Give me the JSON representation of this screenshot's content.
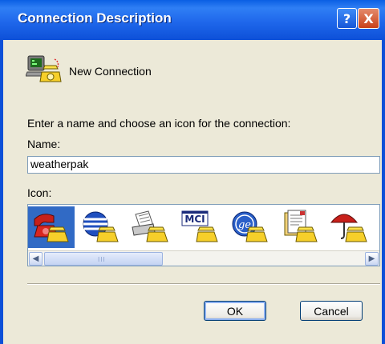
{
  "titlebar": {
    "title": "Connection Description",
    "help_glyph": "?",
    "close_glyph": "X"
  },
  "connection": {
    "icon": "hyperterminal-phone-icon",
    "label": "New Connection"
  },
  "prompt": "Enter a name and choose an icon for the connection:",
  "name_field": {
    "label": "Name:",
    "value": "weatherpak"
  },
  "icon_picker": {
    "label": "Icon:",
    "selected_index": 0,
    "icons": [
      "red-phone-icon",
      "globe-phone-icon",
      "fax-phone-icon",
      "mci-phone-icon",
      "ge-phone-icon",
      "document-phone-icon",
      "umbrella-phone-icon"
    ],
    "scroll_grip": "III"
  },
  "buttons": {
    "ok": "OK",
    "cancel": "Cancel"
  },
  "colors": {
    "titlebar": "#0d50d8",
    "body": "#ece9d8",
    "selection": "#316ac5"
  }
}
